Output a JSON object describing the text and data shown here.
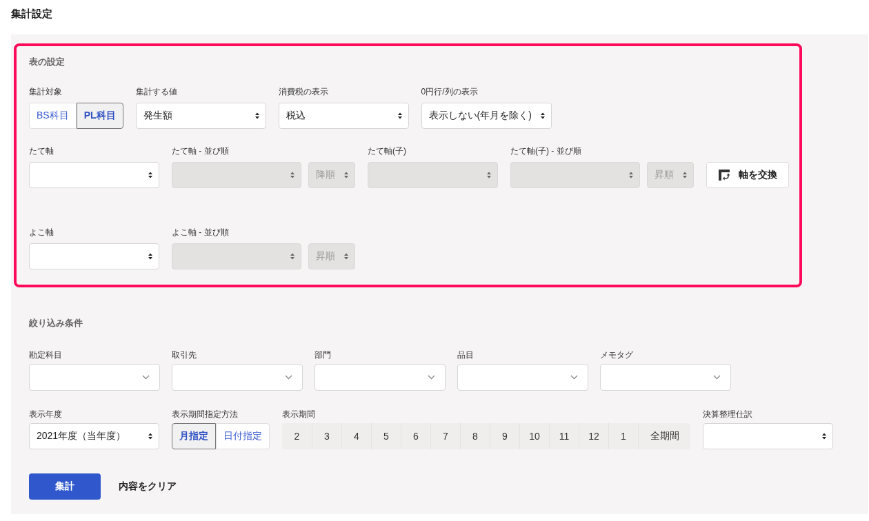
{
  "page": {
    "title": "集計設定"
  },
  "sections": [
    {
      "title": "表の設定",
      "highlighted": true,
      "lines": [
        {
          "fields": [
            {
              "kind": "segmented",
              "label": "集計対象",
              "options": [
                {
                  "label": "BS科目",
                  "selected": false
                },
                {
                  "label": "PL科目",
                  "selected": true
                }
              ]
            },
            {
              "kind": "select",
              "label": "集計する値",
              "value": "発生額",
              "disabled": false
            },
            {
              "kind": "select",
              "label": "消費税の表示",
              "value": "税込",
              "disabled": false
            },
            {
              "kind": "select",
              "label": "0円行/列の表示",
              "value": "表示しない(年月を除く)",
              "disabled": false
            }
          ]
        },
        {
          "fields": [
            {
              "kind": "select",
              "label": "たて軸",
              "disabled": false
            },
            {
              "kind": "sort",
              "label": "たて軸 - 並び順",
              "disabled": true,
              "order": {
                "value": "降順",
                "disabled": true
              }
            },
            {
              "kind": "select",
              "label": "たて軸(子)",
              "disabled": true
            },
            {
              "kind": "sort",
              "label": "たて軸(子) - 並び順",
              "disabled": true,
              "order": {
                "value": "昇順",
                "disabled": true
              }
            },
            {
              "kind": "button",
              "text": "軸を交換"
            }
          ]
        },
        {
          "fields": [
            {
              "kind": "select",
              "label": "よこ軸",
              "disabled": false
            },
            {
              "kind": "sort",
              "label": "よこ軸 - 並び順",
              "disabled": true,
              "order": {
                "value": "昇順",
                "disabled": true
              }
            }
          ]
        }
      ]
    },
    {
      "title": "絞り込み条件",
      "highlighted": false,
      "lines": [
        {
          "fields": [
            {
              "kind": "combobox",
              "label": "勘定科目",
              "disabled": false
            },
            {
              "kind": "combobox",
              "label": "取引先",
              "disabled": false
            },
            {
              "kind": "combobox",
              "label": "部門",
              "disabled": false
            },
            {
              "kind": "combobox",
              "label": "品目",
              "disabled": false
            },
            {
              "kind": "combobox",
              "label": "メモタグ",
              "disabled": false
            }
          ]
        },
        {
          "fields": [
            {
              "kind": "select",
              "label": "表示年度",
              "value": "2021年度（当年度）",
              "disabled": false
            },
            {
              "kind": "segmented",
              "label": "表示期間指定方法",
              "options": [
                {
                  "label": "月指定",
                  "selected": true
                },
                {
                  "label": "日付指定",
                  "selected": false
                }
              ]
            },
            {
              "kind": "period",
              "label": "表示期間",
              "options": [
                {
                  "label": "2",
                  "selected": false
                },
                {
                  "label": "3",
                  "selected": false
                },
                {
                  "label": "4",
                  "selected": false
                },
                {
                  "label": "5",
                  "selected": false
                },
                {
                  "label": "6",
                  "selected": false
                },
                {
                  "label": "7",
                  "selected": false
                },
                {
                  "label": "8",
                  "selected": false
                },
                {
                  "label": "9",
                  "selected": false
                },
                {
                  "label": "10",
                  "selected": false
                },
                {
                  "label": "11",
                  "selected": false
                },
                {
                  "label": "12",
                  "selected": false
                },
                {
                  "label": "1",
                  "selected": false
                },
                {
                  "label": "全期間",
                  "selected": false
                }
              ]
            },
            {
              "kind": "select",
              "label": "決算整理仕訳",
              "disabled": false
            }
          ]
        }
      ]
    }
  ],
  "actions": [
    {
      "kind": "primary",
      "label": "集計"
    },
    {
      "kind": "text",
      "label": "内容をクリア"
    }
  ]
}
